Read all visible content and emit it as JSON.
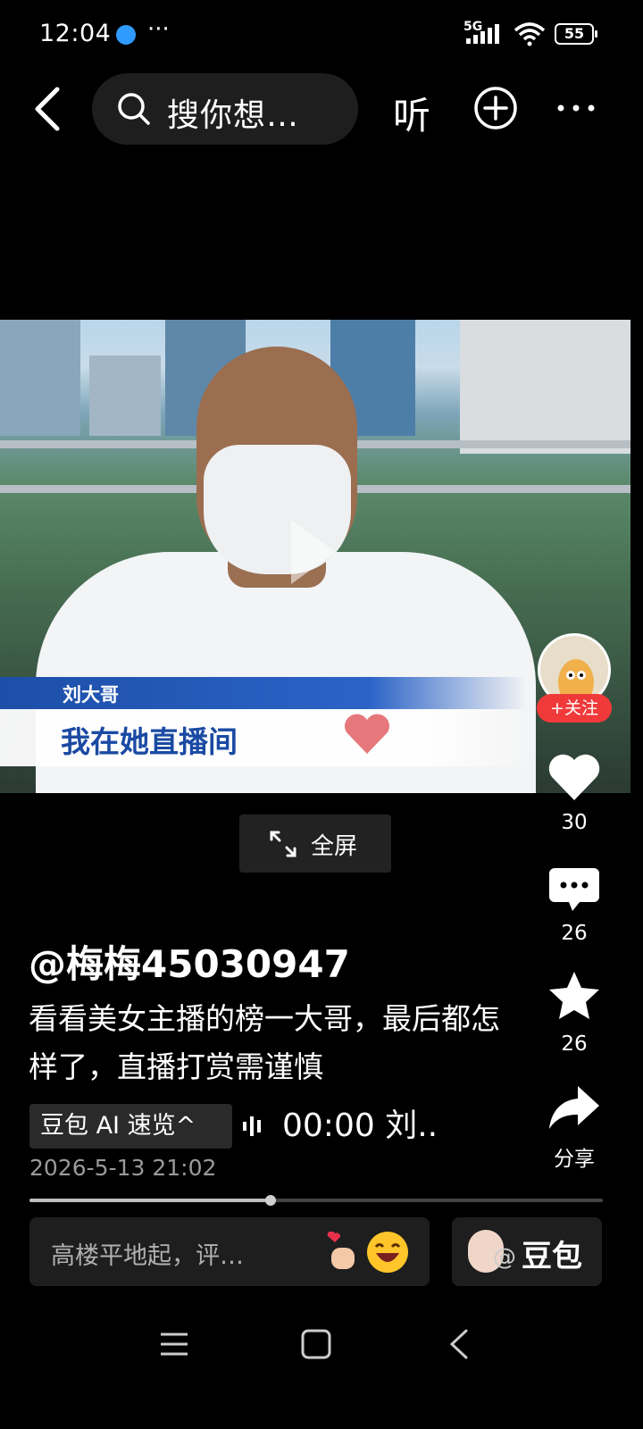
{
  "status_bar": {
    "time": "12:04",
    "more": "···",
    "network": "5G",
    "battery": "55"
  },
  "top_nav": {
    "search_placeholder": "搜你想…",
    "listen_label": "听"
  },
  "video": {
    "caption_name": "刘大哥",
    "caption_text": "我在她直播间",
    "fullscreen_label": "全屏",
    "progress_fraction": 0.42
  },
  "right_rail": {
    "follow_label": "+关注",
    "like_count": "30",
    "comment_count": "26",
    "favorite_count": "26",
    "share_label": "分享"
  },
  "post": {
    "author": "@梅梅45030947",
    "description": "看看美女主播的榜一大哥，最后都怎样了，直播打赏需谨慎",
    "ai_summary_label": "豆包 AI 速览^",
    "audio_text": "00:00 刘..",
    "date": "2026-5-13 21:02"
  },
  "bottom_bar": {
    "comment_placeholder": "高楼平地起，评…",
    "doubao_label": "豆包",
    "doubao_at": "@"
  },
  "colors": {
    "background": "#000000",
    "follow": "#f03a3a",
    "caption_blue": "#1a4aa3"
  },
  "icons": [
    "back-icon",
    "search-icon",
    "add-icon",
    "more-icon",
    "play-icon",
    "heart-icon",
    "comment-icon",
    "star-icon",
    "share-icon",
    "expand-icon",
    "audio-icon",
    "menu-nav-icon",
    "home-nav-icon",
    "back-nav-icon"
  ]
}
